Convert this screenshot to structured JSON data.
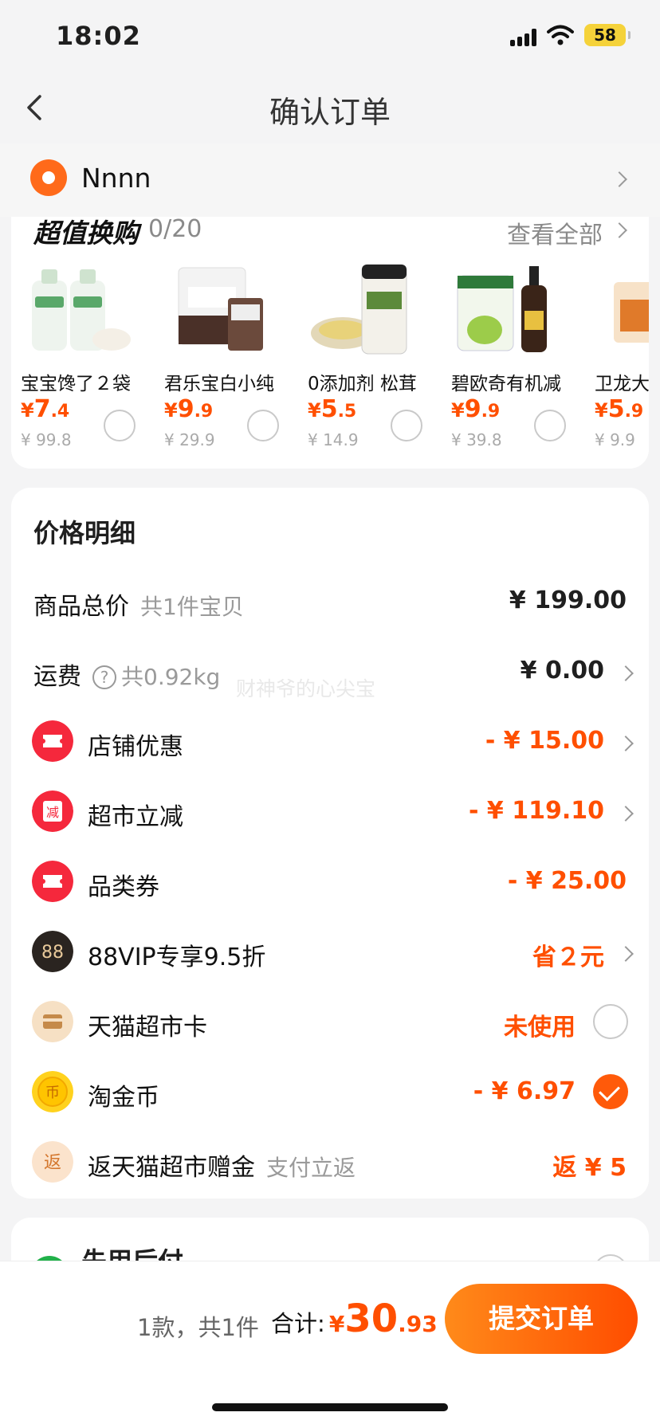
{
  "status": {
    "time": "18:02",
    "battery": "58"
  },
  "nav": {
    "title": "确认订单"
  },
  "address": {
    "name": "Nnnn"
  },
  "upsell": {
    "title": "超值换购",
    "count": "0/20",
    "see_all": "查看全部",
    "products": [
      {
        "name": "宝宝馋了２袋",
        "price_int": "7",
        "price_dec": ".4",
        "orig": "¥ 99.8"
      },
      {
        "name": "君乐宝白小纯",
        "price_int": "9",
        "price_dec": ".9",
        "orig": "¥ 29.9"
      },
      {
        "name": "0添加剂 松茸",
        "price_int": "5",
        "price_dec": ".5",
        "orig": "¥ 14.9"
      },
      {
        "name": "碧欧奇有机减",
        "price_int": "9",
        "price_dec": ".9",
        "orig": "¥ 39.8"
      },
      {
        "name": "卫龙大",
        "price_int": "5",
        "price_dec": ".9",
        "orig": "¥ 9.9"
      }
    ],
    "currency": "¥"
  },
  "price_detail": {
    "title": "价格明细",
    "goods_total": {
      "label": "商品总价",
      "sub": "共1件宝贝",
      "value": "¥ 199.00"
    },
    "shipping": {
      "label": "运费",
      "help": "?",
      "sub": "共0.92kg",
      "value": "¥ 0.00"
    },
    "shop_discount": {
      "label": "店铺优惠",
      "value": "- ¥ 15.00"
    },
    "market_cut": {
      "label": "超市立减",
      "value": "- ¥ 119.10",
      "icon_text": "减"
    },
    "category_coupon": {
      "label": "品类券",
      "value": "- ¥ 25.00"
    },
    "vip": {
      "label": "88VIP专享9.5折",
      "value": "省２元",
      "icon_text": "88"
    },
    "tmall_card": {
      "label": "天猫超市卡",
      "value": "未使用"
    },
    "taojinbi": {
      "label": "淘金币",
      "value": "- ¥ 6.97",
      "icon_text": "币"
    },
    "rebate": {
      "label": "返天猫超市赠金",
      "sub": "支付立返",
      "value": "返 ¥ 5",
      "icon_text": "返"
    }
  },
  "watermark": "财神爷的心尖宝",
  "next_section": {
    "title": "先用后付"
  },
  "footer": {
    "summary": "1款，共1件",
    "total_label": "合计:",
    "currency": "¥",
    "total_int": "30",
    "total_dec": ".93",
    "submit": "提交订单"
  },
  "colors": {
    "accent": "#ff4f00",
    "button_start": "#ff8a1a",
    "button_end": "#ff4d00"
  }
}
